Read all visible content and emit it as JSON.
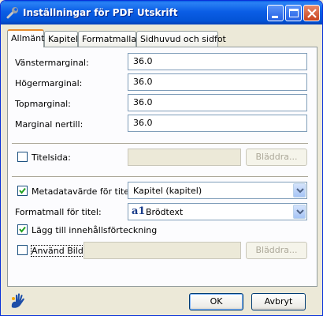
{
  "window": {
    "title": "Inställningar för PDF Utskrift",
    "app_icon": "wrench-icon"
  },
  "tabs": [
    {
      "label": "Allmänt",
      "active": true
    },
    {
      "label": "Kapitel",
      "active": false
    },
    {
      "label": "Formatmallar",
      "active": false
    },
    {
      "label": "Sidhuvud och sidfot",
      "active": false
    }
  ],
  "margins": {
    "left_label": "Vänstermarginal:",
    "left_value": "36.0",
    "right_label": "Högermarginal:",
    "right_value": "36.0",
    "top_label": "Topmarginal:",
    "top_value": "36.0",
    "bottom_label": "Marginal nertill:",
    "bottom_value": "36.0"
  },
  "title_page": {
    "label": "Titelsida:",
    "checked": false,
    "value": "",
    "browse_label": "Bläddra..."
  },
  "metadata_title": {
    "label": "Metadatavärde för titel:",
    "checked": true,
    "selected": "Kapitel (kapitel)"
  },
  "title_style": {
    "label": "Formatmall för titel:",
    "selected": "Brödtext",
    "style_icon_text": "a1",
    "accent_color": "#1a3d8a"
  },
  "toc": {
    "label": "Lägg till innehållsförteckning",
    "checked": true
  },
  "use_image": {
    "label": "Använd Bild:",
    "checked": false,
    "value": "",
    "browse_label": "Bläddra..."
  },
  "footer": {
    "ok_label": "OK",
    "cancel_label": "Avbryt",
    "logo_icon": "hand-logo-icon"
  }
}
